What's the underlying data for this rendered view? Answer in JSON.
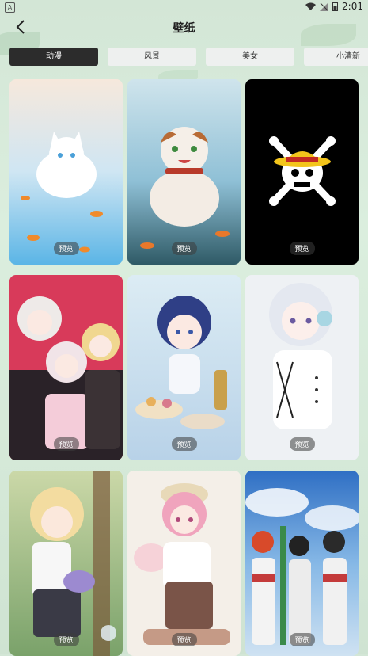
{
  "status": {
    "time": "2:01"
  },
  "header": {
    "title": "壁纸"
  },
  "tabs": [
    {
      "label": "动漫",
      "active": true
    },
    {
      "label": "风景",
      "active": false
    },
    {
      "label": "美女",
      "active": false
    },
    {
      "label": "小清新",
      "active": false
    }
  ],
  "cards": [
    {
      "preview_label": "预览",
      "subject": "white cat with goldfish"
    },
    {
      "preview_label": "预览",
      "subject": "calico cat with goldfish"
    },
    {
      "preview_label": "预览",
      "subject": "straw hat skull and crossbones"
    },
    {
      "preview_label": "预览",
      "subject": "three anime girls"
    },
    {
      "preview_label": "预览",
      "subject": "anime girl with tea set"
    },
    {
      "preview_label": "预览",
      "subject": "white-haired anime girl"
    },
    {
      "preview_label": "预览",
      "subject": "blonde girl with lavender"
    },
    {
      "preview_label": "预览",
      "subject": "pink-haired girl"
    },
    {
      "preview_label": "预览",
      "subject": "students under blue sky"
    }
  ],
  "colors": {
    "active_tab": "#2c2c2c",
    "tab_bg": "#eef0ef",
    "background": "#d8ebdb"
  }
}
